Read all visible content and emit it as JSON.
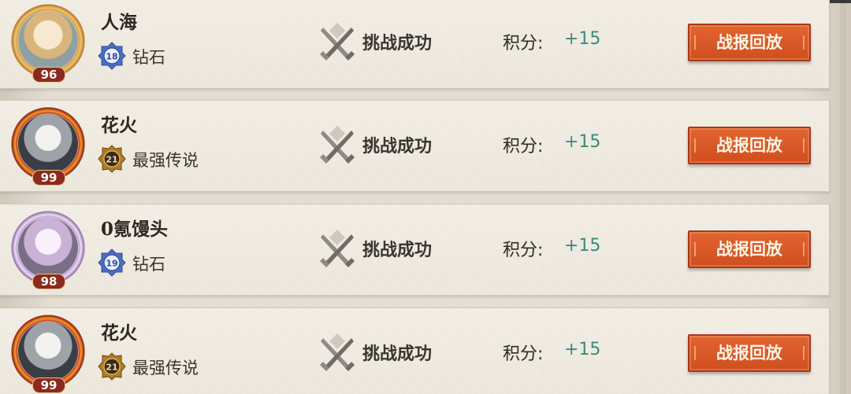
{
  "colors": {
    "accent_button": "#d4572a",
    "score_positive": "#3b8b7a",
    "level_badge": "#8c2a1e",
    "diamond_rank": "#4b6fc7",
    "legend_rank": "#b47a1e"
  },
  "records": [
    {
      "player_name": "人海",
      "player_level": "96",
      "rank_number": "18",
      "rank_name": "钻石",
      "rank_icon": "diamond-rank-icon",
      "result": "挑战成功",
      "score_label": "积分:",
      "score_value": "+15",
      "replay_label": "战报回放",
      "result_icon": "crossed-swords-icon"
    },
    {
      "player_name": "花火",
      "player_level": "99",
      "rank_number": "21",
      "rank_name": "最强传说",
      "rank_icon": "legend-rank-icon",
      "result": "挑战成功",
      "score_label": "积分:",
      "score_value": "+15",
      "replay_label": "战报回放",
      "result_icon": "crossed-swords-icon"
    },
    {
      "player_name": "0氪馒头",
      "player_level": "98",
      "rank_number": "19",
      "rank_name": "钻石",
      "rank_icon": "diamond-rank-icon",
      "result": "挑战成功",
      "score_label": "积分:",
      "score_value": "+15",
      "replay_label": "战报回放",
      "result_icon": "crossed-swords-icon"
    },
    {
      "player_name": "花火",
      "player_level": "99",
      "rank_number": "21",
      "rank_name": "最强传说",
      "rank_icon": "legend-rank-icon",
      "result": "挑战成功",
      "score_label": "积分:",
      "score_value": "+15",
      "replay_label": "战报回放",
      "result_icon": "crossed-swords-icon"
    }
  ]
}
